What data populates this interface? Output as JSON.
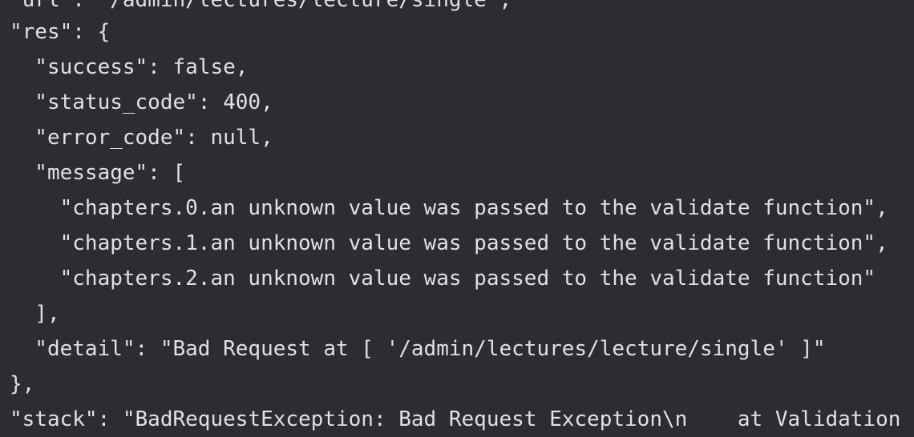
{
  "lines": [
    "\"url\": \"/admin/lectures/lecture/single\",",
    "\"res\": {",
    "  \"success\": false,",
    "  \"status_code\": 400,",
    "  \"error_code\": null,",
    "  \"message\": [",
    "    \"chapters.0.an unknown value was passed to the validate function\",",
    "    \"chapters.1.an unknown value was passed to the validate function\",",
    "    \"chapters.2.an unknown value was passed to the validate function\"",
    "  ],",
    "  \"detail\": \"Bad Request at [ '/admin/lectures/lecture/single' ]\"",
    "},",
    "\"stack\": \"BadRequestException: Bad Request Exception\\n    at Validation"
  ],
  "colors": {
    "background": "#2b2d30",
    "text": "#dfe1e5"
  }
}
